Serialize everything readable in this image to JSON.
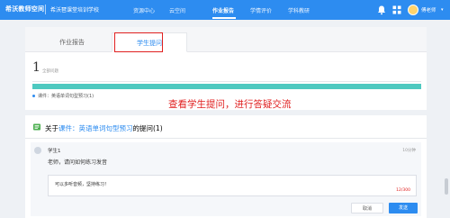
{
  "app": {
    "brand": "希沃教师空间",
    "school": "希沃琶课堂培训学校"
  },
  "nav": {
    "items": [
      "资源中心",
      "云空间",
      "作业报告",
      "学情评价",
      "学科教研"
    ],
    "active": "作业报告"
  },
  "user": {
    "name": "傅老师"
  },
  "tabs": [
    "作业报告",
    "学生提问"
  ],
  "summary": {
    "count": "1",
    "count_label": "全部问题",
    "course_item": "课件：英语单词句型预习(1)",
    "progress_fraction": 1.0
  },
  "annotation": "查看学生提问，进行答疑交流",
  "question_section": {
    "prefix": "关于",
    "course_link": "课件：英语单词句型预习",
    "suffix": "的提问(1)"
  },
  "question": {
    "student": "学生1",
    "time": "10分钟",
    "text": "老师，请问如何练习发音"
  },
  "reply": {
    "text": "可以多听音频，坚持练习！",
    "count": "12/300"
  },
  "buttons": {
    "cancel": "取消",
    "send": "发送"
  },
  "colors": {
    "primary": "#2d8cf0",
    "progress": "#4ec9c0",
    "annotation": "#e02020"
  }
}
